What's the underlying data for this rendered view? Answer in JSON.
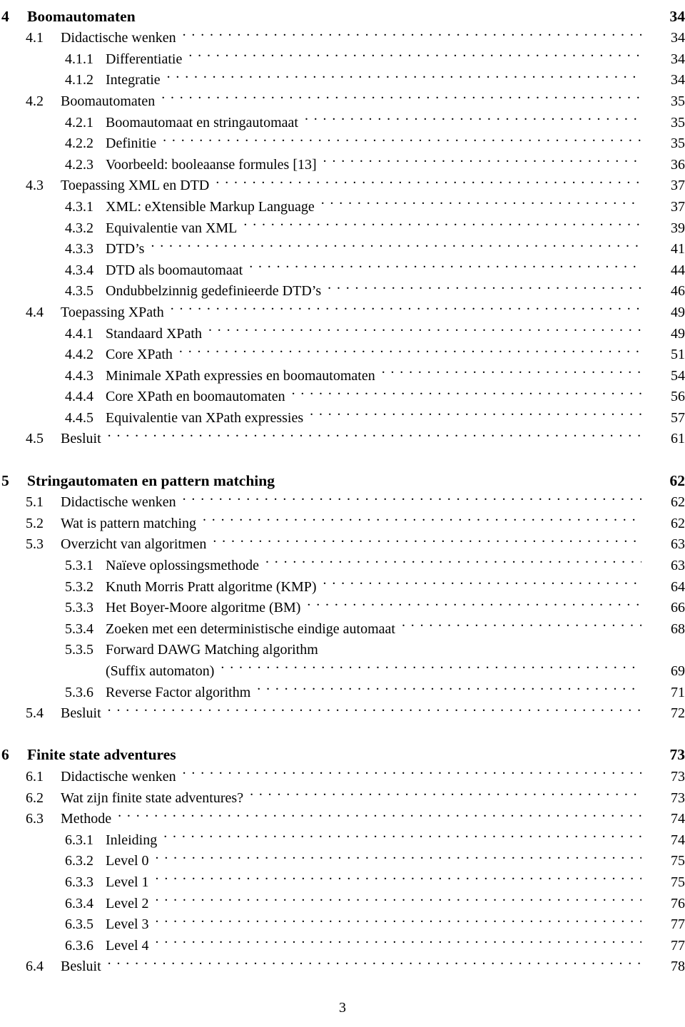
{
  "document": {
    "page_label": "3",
    "type": "table-of-contents"
  },
  "entries": [
    {
      "level": 1,
      "number": "4",
      "title": "Boomautomaten",
      "page": "34",
      "gap_before": false,
      "leader": false
    },
    {
      "level": 2,
      "number": "4.1",
      "title": "Didactische wenken",
      "page": "34",
      "gap_before": false,
      "leader": true
    },
    {
      "level": 3,
      "number": "4.1.1",
      "title": "Differentiatie",
      "page": "34",
      "gap_before": false,
      "leader": true
    },
    {
      "level": 3,
      "number": "4.1.2",
      "title": "Integratie",
      "page": "34",
      "gap_before": false,
      "leader": true
    },
    {
      "level": 2,
      "number": "4.2",
      "title": "Boomautomaten",
      "page": "35",
      "gap_before": false,
      "leader": true
    },
    {
      "level": 3,
      "number": "4.2.1",
      "title": "Boomautomaat en stringautomaat",
      "page": "35",
      "gap_before": false,
      "leader": true
    },
    {
      "level": 3,
      "number": "4.2.2",
      "title": "Definitie",
      "page": "35",
      "gap_before": false,
      "leader": true
    },
    {
      "level": 3,
      "number": "4.2.3",
      "title": "Voorbeeld: booleaanse formules [13]",
      "page": "36",
      "gap_before": false,
      "leader": true
    },
    {
      "level": 2,
      "number": "4.3",
      "title": "Toepassing XML en DTD",
      "page": "37",
      "gap_before": false,
      "leader": true
    },
    {
      "level": 3,
      "number": "4.3.1",
      "title": "XML: eXtensible Markup Language",
      "page": "37",
      "gap_before": false,
      "leader": true
    },
    {
      "level": 3,
      "number": "4.3.2",
      "title": "Equivalentie van XML",
      "page": "39",
      "gap_before": false,
      "leader": true
    },
    {
      "level": 3,
      "number": "4.3.3",
      "title": "DTD’s",
      "page": "41",
      "gap_before": false,
      "leader": true
    },
    {
      "level": 3,
      "number": "4.3.4",
      "title": "DTD als boomautomaat",
      "page": "44",
      "gap_before": false,
      "leader": true
    },
    {
      "level": 3,
      "number": "4.3.5",
      "title": "Ondubbelzinnig gedefinieerde DTD’s",
      "page": "46",
      "gap_before": false,
      "leader": true
    },
    {
      "level": 2,
      "number": "4.4",
      "title": "Toepassing XPath",
      "page": "49",
      "gap_before": false,
      "leader": true
    },
    {
      "level": 3,
      "number": "4.4.1",
      "title": "Standaard XPath",
      "page": "49",
      "gap_before": false,
      "leader": true
    },
    {
      "level": 3,
      "number": "4.4.2",
      "title": "Core XPath",
      "page": "51",
      "gap_before": false,
      "leader": true
    },
    {
      "level": 3,
      "number": "4.4.3",
      "title": "Minimale XPath expressies en boomautomaten",
      "page": "54",
      "gap_before": false,
      "leader": true
    },
    {
      "level": 3,
      "number": "4.4.4",
      "title": "Core XPath en boomautomaten",
      "page": "56",
      "gap_before": false,
      "leader": true
    },
    {
      "level": 3,
      "number": "4.4.5",
      "title": "Equivalentie van XPath expressies",
      "page": "57",
      "gap_before": false,
      "leader": true
    },
    {
      "level": 2,
      "number": "4.5",
      "title": "Besluit",
      "page": "61",
      "gap_before": false,
      "leader": true
    },
    {
      "level": 1,
      "number": "5",
      "title": "Stringautomaten en pattern matching",
      "page": "62",
      "gap_before": true,
      "leader": false
    },
    {
      "level": 2,
      "number": "5.1",
      "title": "Didactische wenken",
      "page": "62",
      "gap_before": false,
      "leader": true
    },
    {
      "level": 2,
      "number": "5.2",
      "title": "Wat is pattern matching",
      "page": "62",
      "gap_before": false,
      "leader": true
    },
    {
      "level": 2,
      "number": "5.3",
      "title": "Overzicht van algoritmen",
      "page": "63",
      "gap_before": false,
      "leader": true
    },
    {
      "level": 3,
      "number": "5.3.1",
      "title": "Naïeve oplossingsmethode",
      "page": "63",
      "gap_before": false,
      "leader": true
    },
    {
      "level": 3,
      "number": "5.3.2",
      "title": "Knuth Morris Pratt algoritme (KMP)",
      "page": "64",
      "gap_before": false,
      "leader": true
    },
    {
      "level": 3,
      "number": "5.3.3",
      "title": "Het Boyer-Moore algoritme (BM)",
      "page": "66",
      "gap_before": false,
      "leader": true
    },
    {
      "level": 3,
      "number": "5.3.4",
      "title": "Zoeken met een deterministische eindige automaat",
      "page": "68",
      "gap_before": false,
      "leader": true
    },
    {
      "level": 3,
      "number": "5.3.5",
      "title": "Forward DAWG Matching algorithm",
      "page": "",
      "gap_before": false,
      "leader": false
    },
    {
      "level": 3,
      "number": "",
      "title": "(Suffix automaton)",
      "page": "69",
      "gap_before": false,
      "leader": true,
      "continuation": true
    },
    {
      "level": 3,
      "number": "5.3.6",
      "title": "Reverse Factor algorithm",
      "page": "71",
      "gap_before": false,
      "leader": true
    },
    {
      "level": 2,
      "number": "5.4",
      "title": "Besluit",
      "page": "72",
      "gap_before": false,
      "leader": true
    },
    {
      "level": 1,
      "number": "6",
      "title": "Finite state adventures",
      "page": "73",
      "gap_before": true,
      "leader": false
    },
    {
      "level": 2,
      "number": "6.1",
      "title": "Didactische wenken",
      "page": "73",
      "gap_before": false,
      "leader": true
    },
    {
      "level": 2,
      "number": "6.2",
      "title": "Wat zijn finite state adventures?",
      "page": "73",
      "gap_before": false,
      "leader": true
    },
    {
      "level": 2,
      "number": "6.3",
      "title": "Methode",
      "page": "74",
      "gap_before": false,
      "leader": true
    },
    {
      "level": 3,
      "number": "6.3.1",
      "title": "Inleiding",
      "page": "74",
      "gap_before": false,
      "leader": true
    },
    {
      "level": 3,
      "number": "6.3.2",
      "title": "Level 0",
      "page": "75",
      "gap_before": false,
      "leader": true
    },
    {
      "level": 3,
      "number": "6.3.3",
      "title": "Level 1",
      "page": "75",
      "gap_before": false,
      "leader": true
    },
    {
      "level": 3,
      "number": "6.3.4",
      "title": "Level 2",
      "page": "76",
      "gap_before": false,
      "leader": true
    },
    {
      "level": 3,
      "number": "6.3.5",
      "title": "Level 3",
      "page": "77",
      "gap_before": false,
      "leader": true
    },
    {
      "level": 3,
      "number": "6.3.6",
      "title": "Level 4",
      "page": "77",
      "gap_before": false,
      "leader": true
    },
    {
      "level": 2,
      "number": "6.4",
      "title": "Besluit",
      "page": "78",
      "gap_before": false,
      "leader": true
    }
  ]
}
